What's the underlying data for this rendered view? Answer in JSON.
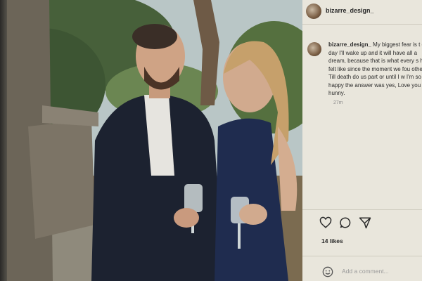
{
  "post": {
    "header_username": "bizarre_design_",
    "comment_username": "bizarre_design_",
    "comment_text": "My biggest fear is t one day I'll wake up and it will have all a dream, because that is what every s has felt like since the moment we fou other. Till death do us part or until I w I'm so happy the answer was yes, Love you hunny.",
    "time": "27m",
    "likes": "14 likes",
    "add_comment_placeholder": "Add a comment..."
  },
  "icons": [
    "heart-icon",
    "comment-icon",
    "share-icon",
    "smile-icon"
  ],
  "colors": {
    "panel_bg": "#e9e6dc",
    "text": "#2a2a2a"
  }
}
